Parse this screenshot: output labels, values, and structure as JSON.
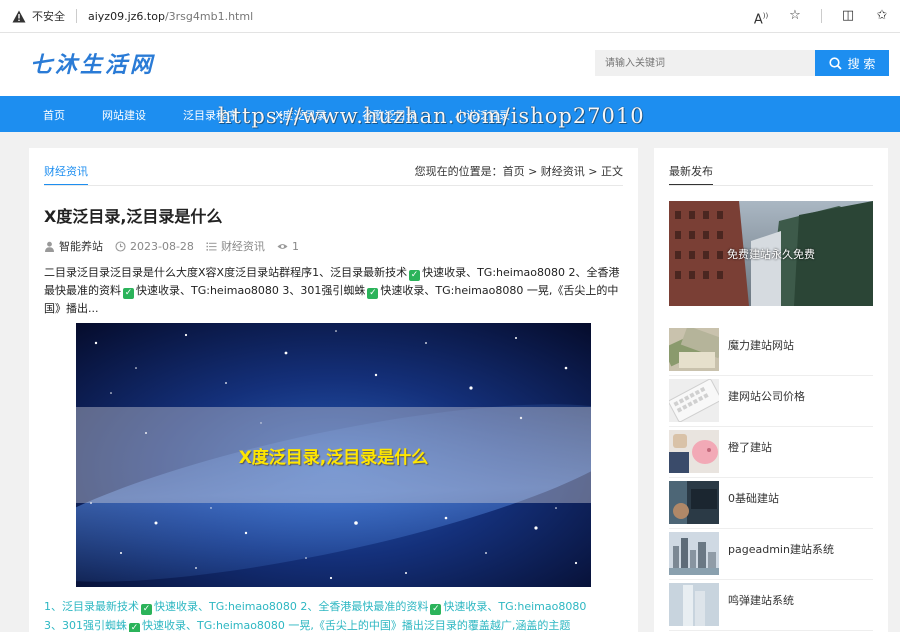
{
  "browser": {
    "security_label": "不安全",
    "url_domain": "aiyz09.jz6.top",
    "url_path": "/3rsg4mb1.html",
    "icons": [
      "read-aloud-icon",
      "favorite-star-icon",
      "split-screen-icon",
      "favorites-icon"
    ]
  },
  "header": {
    "logo_text": "七沐生活网",
    "search_placeholder": "请输入关键词",
    "search_button": "搜 索"
  },
  "nav": {
    "items": [
      {
        "label": "首页"
      },
      {
        "label": "网站建设"
      },
      {
        "label": "泛目录程序"
      },
      {
        "label": "X度泛目录"
      },
      {
        "label": "谷歌泛目录"
      },
      {
        "label": "小说泛目录"
      }
    ],
    "watermark": "https://www.huzhan.com/ishop27010"
  },
  "main": {
    "category_tab": "财经资讯",
    "breadcrumb": "您现在的位置是：首页 > 财经资讯 > 正文",
    "title": "X度泛目录,泛目录是什么",
    "meta": {
      "author": "智能养站",
      "date": "2023-08-28",
      "category": "财经资讯",
      "views": "1"
    },
    "summary": {
      "part1": "二目录泛目录泛目录是什么大度X容X度泛目录站群程序1、泛目录最新技术",
      "part2": "快速收录、TG:heimao8080 2、全香港最快最准的资料",
      "part3": "快速收录、TG:heimao8080 3、301强引蜘蛛",
      "part4": "快速收录、TG:heimao8080 一晃,《舌尖上的中国》播出..."
    },
    "hero_caption": "X度泛目录,泛目录是什么",
    "body": {
      "part1": "1、泛目录最新技术",
      "part2": "快速收录、TG:heimao8080 2、全香港最快最准的资料",
      "part3": "快速收录、TG:heimao8080",
      "part4": "3、301强引蜘蛛",
      "part5": "快速收录、TG:heimao8080 一晃,《舌尖上的中国》播出泛目录的覆盖越广,涵盖的主题"
    }
  },
  "sidebar": {
    "title": "最新发布",
    "featured_label": "免费建站永久免费",
    "items": [
      {
        "label": "魔力建站网站"
      },
      {
        "label": "建网站公司价格"
      },
      {
        "label": "橙了建站"
      },
      {
        "label": "0基础建站"
      },
      {
        "label": "pageadmin建站系统"
      },
      {
        "label": "鸣弹建站系统"
      }
    ]
  },
  "colors": {
    "accent": "#1d8ef0",
    "body_link": "#2db7c2",
    "hero_caption": "#ffe600",
    "check": "#2bb35a"
  }
}
